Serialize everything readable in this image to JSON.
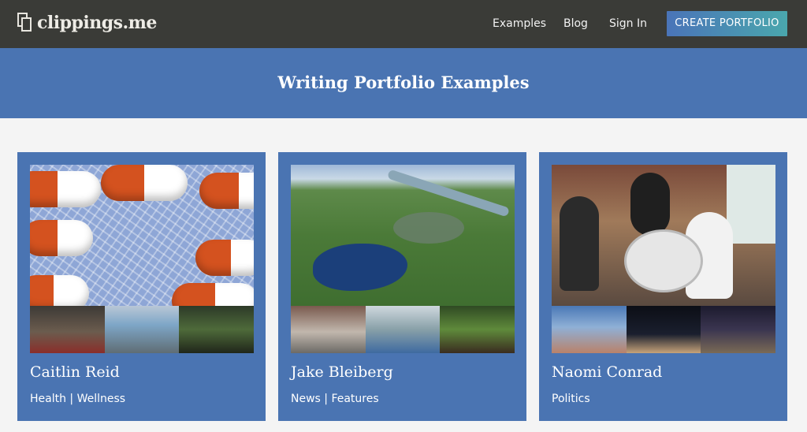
{
  "header": {
    "logo_text": "clippings.me",
    "nav": {
      "examples": "Examples",
      "blog": "Blog",
      "sign_in": "Sign In"
    },
    "cta_label": "CREATE PORTFOLIO"
  },
  "hero": {
    "title": "Writing Portfolio Examples"
  },
  "cards": [
    {
      "name": "Caitlin Reid",
      "tags": "Health | Wellness"
    },
    {
      "name": "Jake Bleiberg",
      "tags": "News | Features"
    },
    {
      "name": "Naomi Conrad",
      "tags": "Politics"
    }
  ],
  "colors": {
    "header_bg": "#3a3b37",
    "hero_bg": "#4a74b2",
    "card_bg": "#4a74b2",
    "cta_gradient_start": "#4a74b8",
    "cta_gradient_end": "#4aa7ad"
  }
}
